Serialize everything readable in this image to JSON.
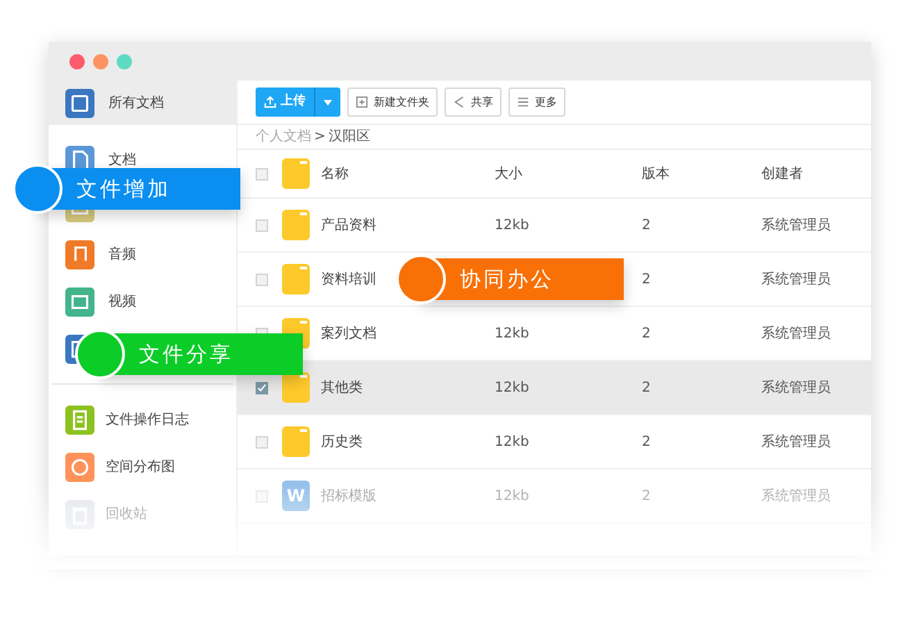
{
  "sidebar": {
    "items": [
      {
        "kind": "all",
        "label": "所有文档",
        "selected": true
      },
      {
        "kind": "doc",
        "label": "文档",
        "selected": false
      },
      {
        "kind": "image",
        "selected": false
      },
      {
        "kind": "audio",
        "label": "音频",
        "selected": false
      },
      {
        "kind": "video",
        "label": "视频",
        "selected": false
      },
      {
        "kind": "other",
        "selected": false
      }
    ],
    "tools": [
      {
        "kind": "log",
        "label": "文件操作日志"
      },
      {
        "kind": "chart",
        "label": "空间分布图"
      },
      {
        "kind": "trash",
        "label": "回收站"
      }
    ]
  },
  "toolbar": {
    "upload": "上传",
    "buttons": [
      {
        "kind": "new-folder",
        "label": "新建文件夹"
      },
      {
        "kind": "share",
        "label": "共享"
      },
      {
        "kind": "more",
        "label": "更多"
      }
    ]
  },
  "breadcrumb": {
    "parent": "个人文档",
    "separator": ">",
    "current": "汉阳区"
  },
  "table": {
    "columns": [
      "名称",
      "大小",
      "版本",
      "创建者"
    ],
    "header_checked": false,
    "rows": [
      {
        "kind": "folder",
        "name": "产品资料",
        "size": "12kb",
        "version": "2",
        "creator": "系统管理员",
        "checked": false
      },
      {
        "kind": "folder",
        "name": "资料培训",
        "version": "2",
        "creator": "系统管理员",
        "checked": false
      },
      {
        "kind": "folder",
        "name": "案列文档",
        "size": "12kb",
        "version": "2",
        "creator": "系统管理员",
        "checked": false
      },
      {
        "kind": "folder",
        "name": "其他类",
        "size": "12kb",
        "version": "2",
        "creator": "系统管理员",
        "checked": true
      },
      {
        "kind": "folder",
        "name": "历史类",
        "size": "12kb",
        "version": "2",
        "creator": "系统管理员",
        "checked": false
      },
      {
        "kind": "word",
        "icon_letter": "W",
        "name": "招标模版",
        "size": "12kb",
        "version": "2",
        "creator": "系统管理员",
        "checked": false
      }
    ]
  },
  "callouts": [
    {
      "label": "文件增加",
      "color": "#0a8ff0"
    },
    {
      "label": "协同办公",
      "color": "#f87006"
    },
    {
      "label": "文件分享",
      "color": "#0ccc28"
    }
  ]
}
